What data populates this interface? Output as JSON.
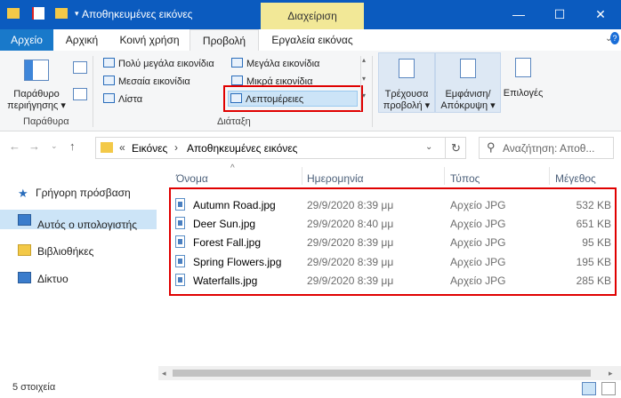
{
  "window": {
    "title": "Αποθηκευμένες εικόνες",
    "context_tab": "Διαχείριση",
    "controls": {
      "minimize": "—",
      "maximize": "☐",
      "close": "✕"
    }
  },
  "ribbon_tabs": [
    "Αρχείο",
    "Αρχική",
    "Κοινή χρήση",
    "Προβολή",
    "Εργαλεία εικόνας"
  ],
  "ribbon": {
    "navigation_pane_label_1": "Παράθυρο",
    "navigation_pane_label_2": "περιήγησης",
    "panes_group": "Παράθυρα",
    "layout_items": {
      "extra_large": "Πολύ μεγάλα εικονίδια",
      "large": "Μεγάλα εικονίδια",
      "medium": "Μεσαία εικονίδια",
      "small": "Μικρά εικονίδια",
      "list": "Λίστα",
      "details": "Λεπτομέρειες"
    },
    "layout_group": "Διάταξη",
    "current_view_1": "Τρέχουσα",
    "current_view_2": "προβολή",
    "show_hide_1": "Εμφάνιση/",
    "show_hide_2": "Απόκρυψη",
    "options": "Επιλογές"
  },
  "address": {
    "crumb_sep": "«",
    "path_1": "Εικόνες",
    "arrow": "›",
    "path_2": "Αποθηκευμένες εικόνες",
    "search_placeholder": "Αναζήτηση: Αποθ..."
  },
  "nav": [
    {
      "label": "Γρήγορη πρόσβαση",
      "icon": "star-icon"
    },
    {
      "label": "Αυτός ο υπολογιστής",
      "icon": "computer-icon"
    },
    {
      "label": "Βιβλιοθήκες",
      "icon": "library-icon"
    },
    {
      "label": "Δίκτυο",
      "icon": "network-icon"
    }
  ],
  "columns": {
    "name": "Όνομα",
    "date": "Ημερομηνία",
    "type": "Τύπος",
    "size": "Μέγεθος"
  },
  "files": [
    {
      "name": "Autumn Road.jpg",
      "date": "29/9/2020 8:39 μμ",
      "type": "Αρχείο JPG",
      "size": "532 KB"
    },
    {
      "name": "Deer Sun.jpg",
      "date": "29/9/2020 8:40 μμ",
      "type": "Αρχείο JPG",
      "size": "651 KB"
    },
    {
      "name": "Forest Fall.jpg",
      "date": "29/9/2020 8:39 μμ",
      "type": "Αρχείο JPG",
      "size": "95 KB"
    },
    {
      "name": "Spring Flowers.jpg",
      "date": "29/9/2020 8:39 μμ",
      "type": "Αρχείο JPG",
      "size": "195 KB"
    },
    {
      "name": "Waterfalls.jpg",
      "date": "29/9/2020 8:39 μμ",
      "type": "Αρχείο JPG",
      "size": "285 KB"
    }
  ],
  "status": "5 στοιχεία",
  "colors": {
    "titlebar": "#0b5bbf",
    "file_tab": "#1979ca",
    "context_tab": "#f2e897",
    "highlight": "#e00000"
  }
}
